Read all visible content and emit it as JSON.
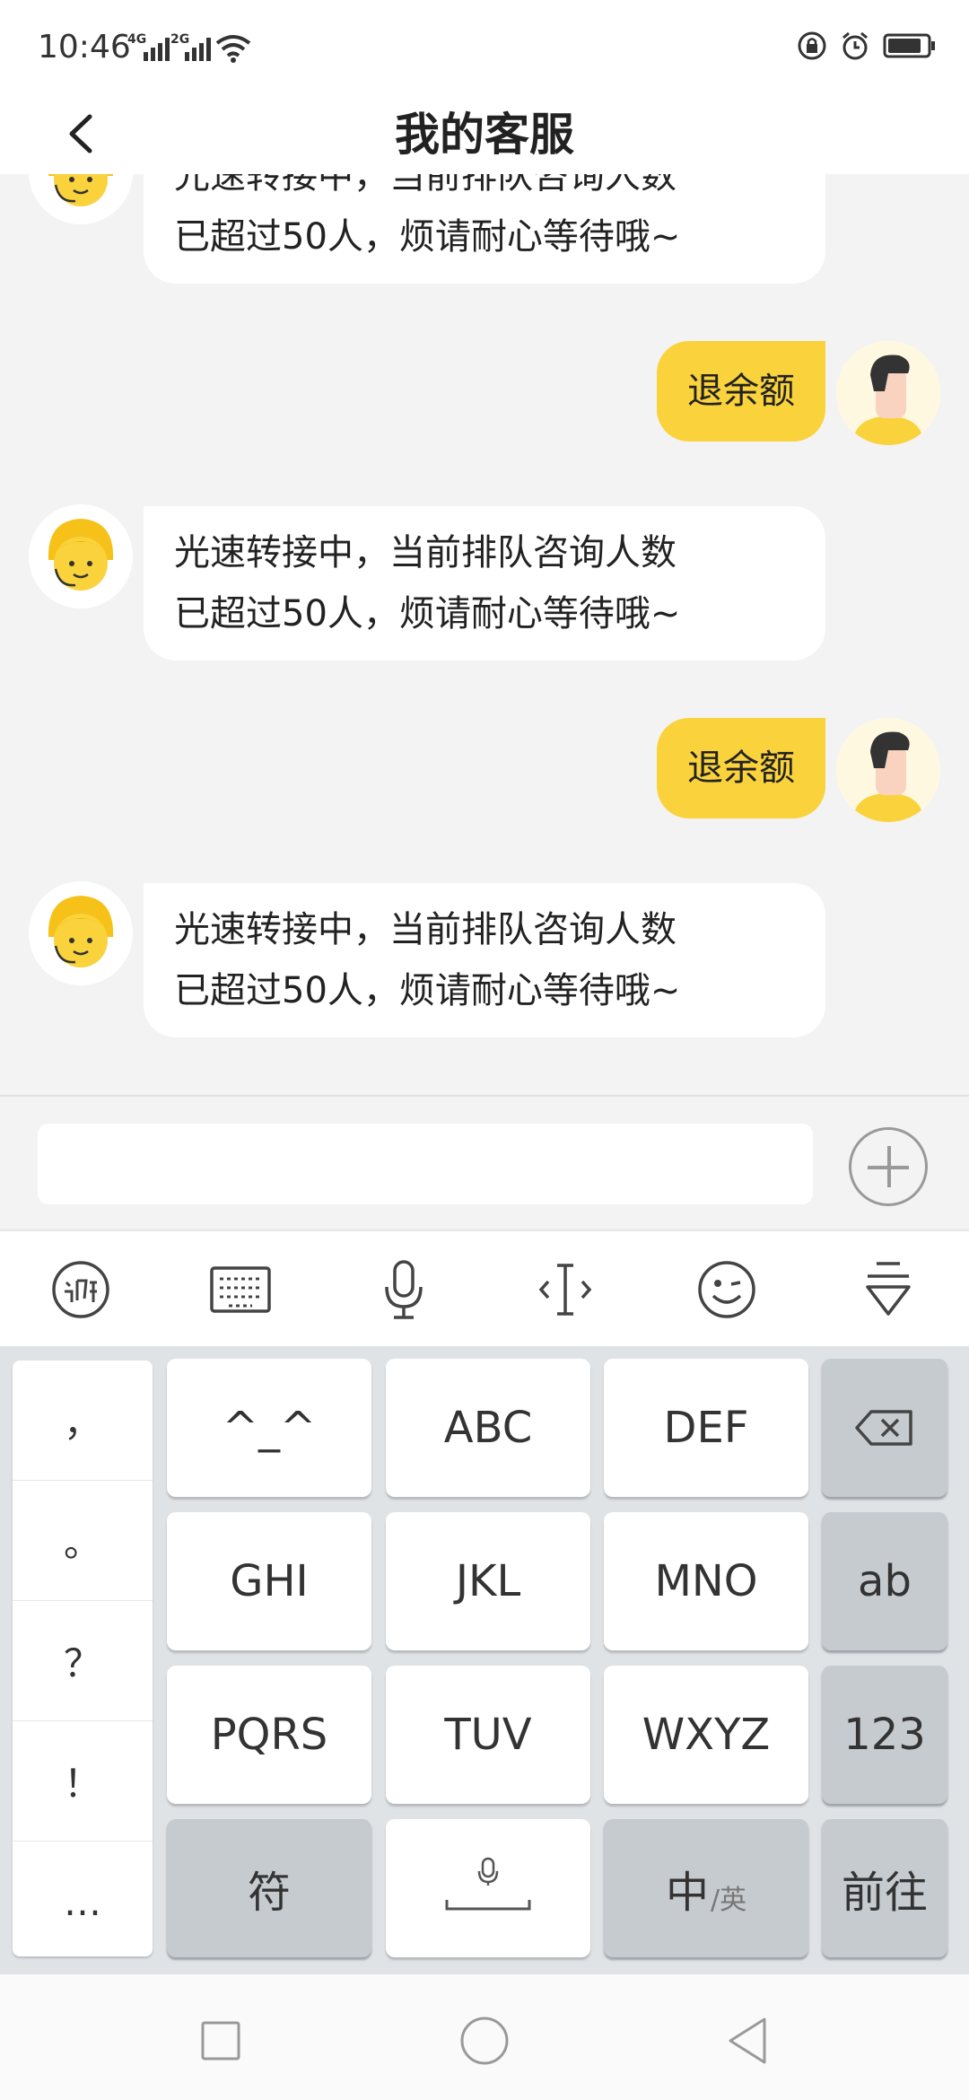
{
  "status_bar": {
    "time": "10:46",
    "net1": "4G",
    "net2": "2G"
  },
  "header": {
    "title": "我的客服"
  },
  "messages": [
    {
      "from": "cs",
      "line1": "光速转接中，当前排队咨询人数",
      "line2": "已超过50人，烦请耐心等待哦~"
    },
    {
      "from": "user",
      "text": "退余额"
    },
    {
      "from": "cs",
      "line1": "光速转接中，当前排队咨询人数",
      "line2": "已超过50人，烦请耐心等待哦~"
    },
    {
      "from": "user",
      "text": "退余额"
    },
    {
      "from": "cs",
      "line1": "光速转接中，当前排队咨询人数",
      "line2": "已超过50人，烦请耐心等待哦~"
    }
  ],
  "input": {
    "value": "",
    "placeholder": ""
  },
  "keyboard": {
    "punctuation": [
      "，",
      "。",
      "？",
      "！",
      "…"
    ],
    "rows": [
      [
        "^_^",
        "ABC",
        "DEF"
      ],
      [
        "GHI",
        "JKL",
        "MNO"
      ],
      [
        "PQRS",
        "TUV",
        "WXYZ"
      ]
    ],
    "right_keys": [
      "ab",
      "123"
    ],
    "bottom": {
      "symbol": "符",
      "chinese": "中",
      "english": "英",
      "go": "前往"
    }
  },
  "colors": {
    "accent": "#fad23c",
    "background": "#f3f3f3",
    "bubble_cs": "#ffffff",
    "keyboard_bg": "#dfe3e6",
    "key_gray": "#c6cbd0"
  },
  "icons": {
    "back": "chevron-left-icon",
    "plus": "plus-circle-icon",
    "voice_ime": "xunfei-logo-icon",
    "keyboard": "keyboard-icon",
    "mic": "microphone-icon",
    "cursor": "cursor-move-icon",
    "emoji": "wink-face-icon",
    "hide_keyboard": "hide-keyboard-icon",
    "backspace": "backspace-icon"
  }
}
